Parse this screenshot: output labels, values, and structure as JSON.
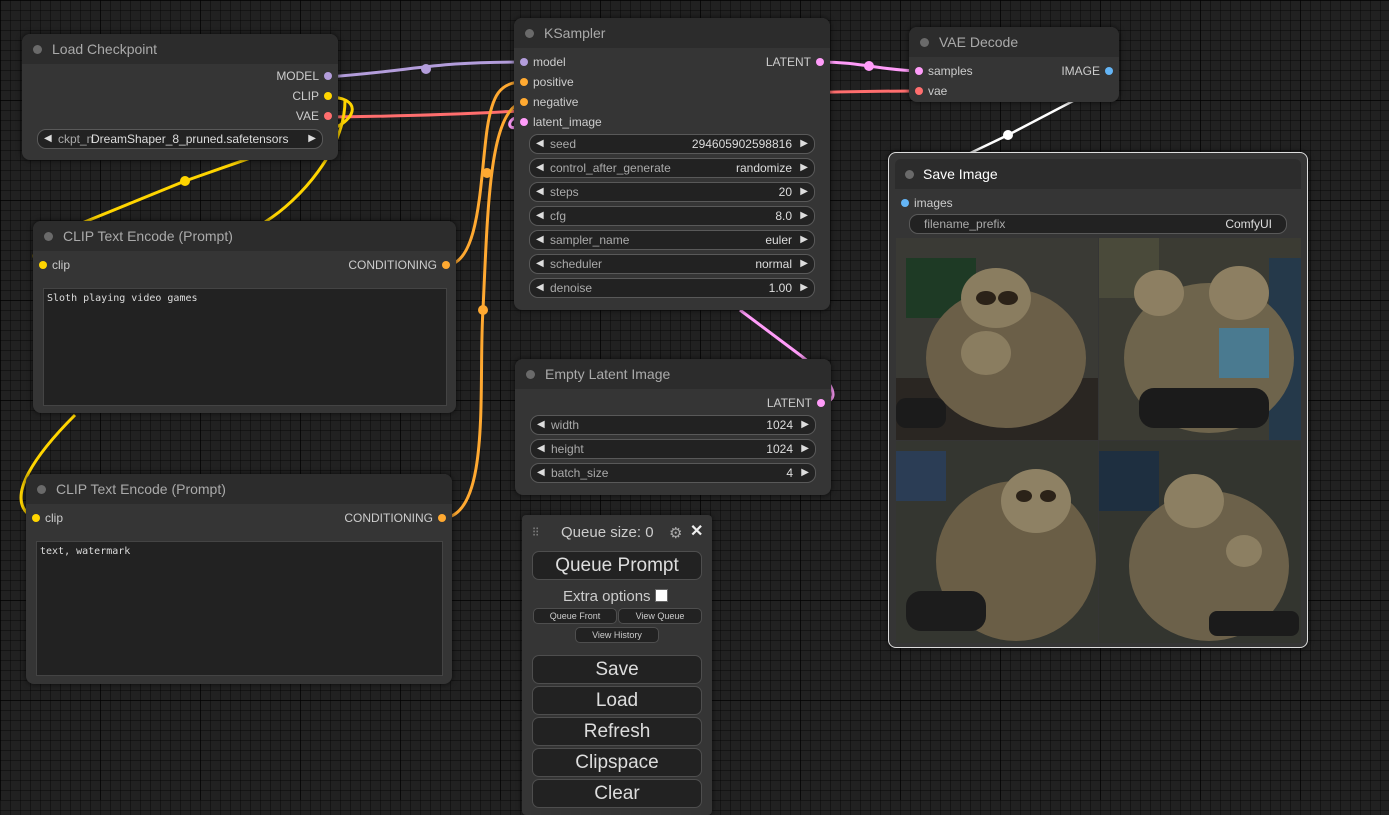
{
  "colors": {
    "model": "#b39ddb",
    "clip": "#ffd500",
    "vae": "#ff6e6e",
    "conditioning": "#ffa931",
    "latent": "#ff9cf9",
    "image": "#64b5f6"
  },
  "load_checkpoint": {
    "title": "Load Checkpoint",
    "outputs": [
      "MODEL",
      "CLIP",
      "VAE"
    ],
    "ckpt_label": "ckpt_n",
    "ckpt_value": "DreamShaper_8_pruned.safetensors"
  },
  "clip_pos": {
    "title": "CLIP Text Encode (Prompt)",
    "input": "clip",
    "output": "CONDITIONING",
    "text": "Sloth playing video games"
  },
  "clip_neg": {
    "title": "CLIP Text Encode (Prompt)",
    "input": "clip",
    "output": "CONDITIONING",
    "text": "text, watermark"
  },
  "ksampler": {
    "title": "KSampler",
    "inputs": [
      "model",
      "positive",
      "negative",
      "latent_image"
    ],
    "output": "LATENT",
    "widgets": [
      {
        "name": "seed",
        "value": "294605902598816"
      },
      {
        "name": "control_after_generate",
        "value": "randomize"
      },
      {
        "name": "steps",
        "value": "20"
      },
      {
        "name": "cfg",
        "value": "8.0"
      },
      {
        "name": "sampler_name",
        "value": "euler"
      },
      {
        "name": "scheduler",
        "value": "normal"
      },
      {
        "name": "denoise",
        "value": "1.00"
      }
    ]
  },
  "empty_latent": {
    "title": "Empty Latent Image",
    "output": "LATENT",
    "widgets": [
      {
        "name": "width",
        "value": "1024"
      },
      {
        "name": "height",
        "value": "1024"
      },
      {
        "name": "batch_size",
        "value": "4"
      }
    ]
  },
  "vae_decode": {
    "title": "VAE Decode",
    "inputs": [
      "samples",
      "vae"
    ],
    "output": "IMAGE"
  },
  "save_image": {
    "title": "Save Image",
    "input": "images",
    "prefix_label": "filename_prefix",
    "prefix_value": "ComfyUI"
  },
  "queue": {
    "size_label": "Queue size: 0",
    "queue_prompt": "Queue Prompt",
    "extra_options": "Extra options",
    "queue_front": "Queue Front",
    "view_queue": "View Queue",
    "view_history": "View History",
    "save": "Save",
    "load": "Load",
    "refresh": "Refresh",
    "clipspace": "Clipspace",
    "clear": "Clear",
    "settings_icon": "gear-icon",
    "close_icon": "close-icon",
    "drag_icon": "drag-handle-icon"
  }
}
